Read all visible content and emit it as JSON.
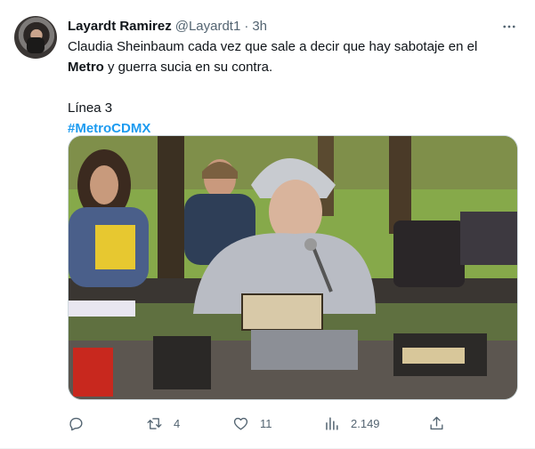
{
  "tweet": {
    "author_name": "Layardt Ramirez",
    "author_handle": "@Layardt1",
    "separator": "·",
    "time": "3h",
    "text": {
      "line1": "Claudia Sheinbaum cada vez que sale a decir que hay sabotaje en el",
      "line2_bold": "Metro",
      "line2_rest": " y guerra sucia en su contra.",
      "line3": "Línea 3",
      "hashtag": "#MetroCDMX"
    },
    "media": {
      "description_icon": "photo"
    },
    "stats": {
      "replies": "",
      "retweets": "4",
      "likes": "11",
      "views": "2.149"
    }
  },
  "colors": {
    "accent": "#1d9bf0",
    "secondary_text": "#536471",
    "primary_text": "#0f1419"
  },
  "icons": {
    "more": "more-horizontal-icon",
    "reply": "reply-icon",
    "retweet": "retweet-icon",
    "like": "heart-icon",
    "views": "views-chart-icon",
    "share": "share-icon"
  }
}
